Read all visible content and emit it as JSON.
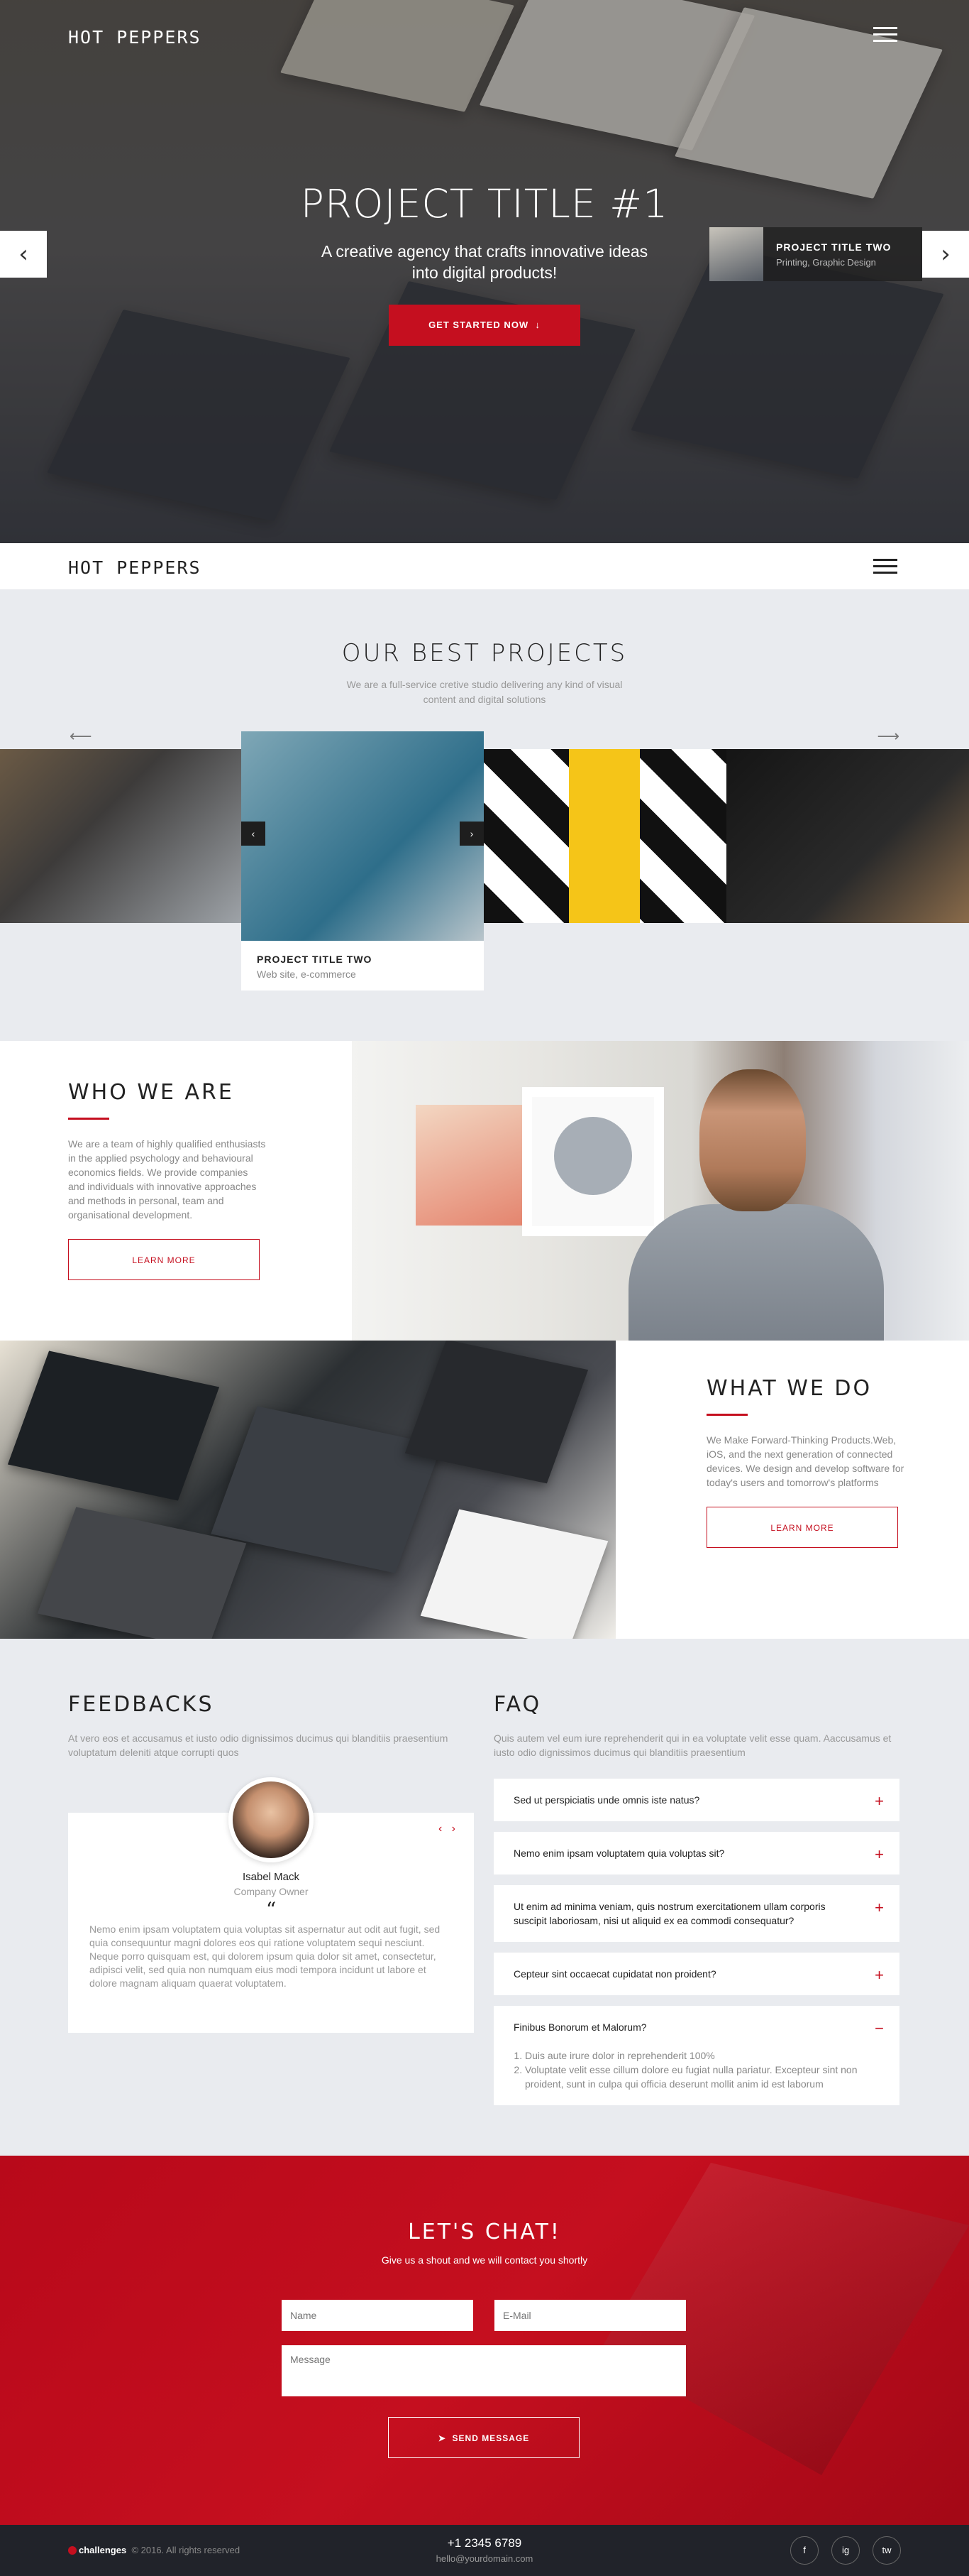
{
  "brand": {
    "logo": "HOT PEPPERS"
  },
  "hero": {
    "title": "PROJECT TITLE #1",
    "subtitle": "A creative agency that crafts innovative ideas into digital products!",
    "cta": "GET STARTED NOW",
    "prev_icon": "chevron-left-icon",
    "next_icon": "chevron-right-icon",
    "next_project": {
      "title": "PROJECT TITLE TWO",
      "tags": "Printing, Graphic Design"
    }
  },
  "projects": {
    "title": "OUR BEST PROJECTS",
    "subtitle": "We are a full-service cretive studio delivering any kind of visual content and digital solutions",
    "active": {
      "title": "PROJECT TITLE TWO",
      "tags": "Web site, e-commerce"
    }
  },
  "who": {
    "title": "WHO WE ARE",
    "text": "We are a team of highly qualified enthusiasts in the applied psychology and behavioural economics fields. We provide companies and individuals with innovative approaches and methods in personal, team and organisational development.",
    "button": "LEARN MORE"
  },
  "what": {
    "title": "WHAT WE DO",
    "text": "We Make Forward-Thinking Products.Web, iOS, and the next generation of connected devices. We design and develop software for today's users and tomorrow's platforms",
    "button": "LEARN MORE"
  },
  "feedbacks": {
    "title": "FEEDBACKS",
    "text": "At vero eos et accusamus et iusto odio dignissimos ducimus qui blanditiis praesentium voluptatum deleniti atque corrupti quos",
    "name": "Isabel Mack",
    "role": "Company Owner",
    "quote": "Nemo enim ipsam voluptatem quia voluptas sit aspernatur aut odit aut fugit, sed quia consequuntur magni dolores eos qui ratione voluptatem sequi nesciunt. Neque porro quisquam est, qui dolorem ipsum quia dolor sit amet, consectetur, adipisci velit, sed quia non numquam eius modi tempora incidunt ut labore et dolore magnam aliquam quaerat voluptatem."
  },
  "faq": {
    "title": "FAQ",
    "text": "Quis autem vel eum iure reprehenderit qui in ea voluptate velit esse quam. Aaccusamus et iusto odio dignissimos ducimus qui blanditiis praesentium",
    "items": [
      {
        "q": "Sed ut perspiciatis unde omnis iste natus?",
        "icon": "+"
      },
      {
        "q": "Nemo enim ipsam voluptatem quia voluptas sit?",
        "icon": "+"
      },
      {
        "q": "Ut enim ad minima veniam, quis nostrum exercitationem ullam corporis suscipit laboriosam, nisi ut aliquid ex ea commodi consequatur?",
        "icon": "+"
      },
      {
        "q": "Cepteur sint occaecat cupidatat non proident?",
        "icon": "+"
      },
      {
        "q": "Finibus Bonorum et Malorum?",
        "icon": "−"
      }
    ],
    "open_answers": [
      "Duis aute irure dolor in reprehenderit 100%",
      "Voluptate velit esse cillum dolore eu fugiat nulla pariatur. Excepteur sint non proident, sunt in culpa qui officia deserunt mollit anim id est laborum"
    ]
  },
  "chat": {
    "title": "LET'S CHAT!",
    "subtitle": "Give us a shout and we will contact you shortly",
    "name_placeholder": "Name",
    "email_placeholder": "E-Mail",
    "message_placeholder": "Message",
    "send": "SEND MESSAGE"
  },
  "footer": {
    "brand": "challenges",
    "copyright": "© 2016. All rights reserved",
    "phone": "+1 2345 6789",
    "email": "hello@yourdomain.com",
    "socials": [
      "f",
      "ig",
      "tw"
    ]
  },
  "colors": {
    "accent": "#c50f1f",
    "light_bg": "#e9ebef",
    "footer_bg": "#21232a"
  }
}
